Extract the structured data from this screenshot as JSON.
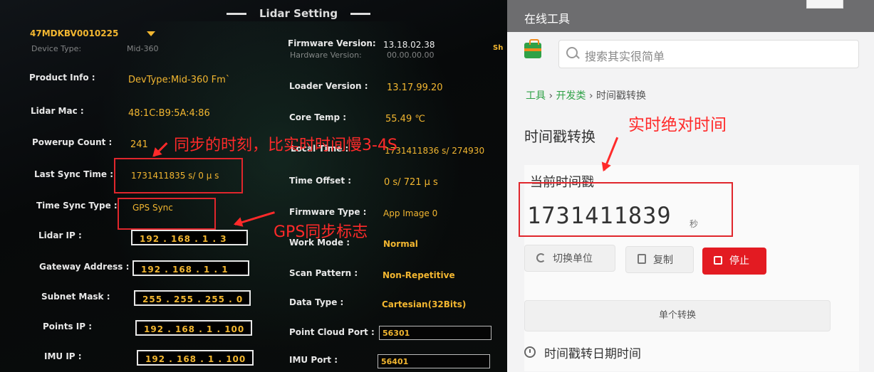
{
  "lidar": {
    "title": "Lidar Setting",
    "device_id": "47MDKBV0010225",
    "cut_top_left": "Device Type:",
    "cut_top_left_value": "Mid-360",
    "cut_top_right": "Hardware Version:",
    "cut_top_right_value": "00.00.00.00",
    "sh_label": "Sh",
    "left_fields": [
      {
        "label": "Product Info :",
        "value": "DevType:Mid-360 Fm`"
      },
      {
        "label": "Lidar Mac :",
        "value": "48:1C:B9:5A:4:86"
      },
      {
        "label": "Powerup Count :",
        "value": "241"
      },
      {
        "label": "Last Sync Time :",
        "value": "1731411835 s/ 0 μ s"
      },
      {
        "label": "Time Sync Type :",
        "value": "GPS Sync"
      }
    ],
    "ip_fields": [
      {
        "label": "Lidar IP :",
        "value": "192 . 168 . 1 . 3"
      },
      {
        "label": "Gateway Address :",
        "value": "192 . 168 . 1 . 1"
      },
      {
        "label": "Subnet Mask :",
        "value": "255 . 255 . 255 . 0"
      },
      {
        "label": "Points IP :",
        "value": "192 . 168 . 1 . 100"
      },
      {
        "label": "IMU IP :",
        "value": "192 . 168 . 1 . 100"
      }
    ],
    "right_fields": [
      {
        "label": "Firmware Version:",
        "value": "13.18.02.38"
      },
      {
        "label": "Loader Version :",
        "value": "13.17.99.20"
      },
      {
        "label": "Core Temp :",
        "value": "55.49 ℃"
      },
      {
        "label": "Local Time :",
        "value": "1731411836 s/ 274930"
      },
      {
        "label": "Time Offset :",
        "value": "0 s/ 721 μ s"
      },
      {
        "label": "Firmware Type :",
        "value": "App Image 0"
      }
    ],
    "selects": [
      {
        "label": "Work Mode :",
        "value": "Normal"
      },
      {
        "label": "Scan Pattern :",
        "value": "Non-Repetitive"
      },
      {
        "label": "Data Type :",
        "value": "Cartesian(32Bits)"
      }
    ],
    "ports": [
      {
        "label": "Point Cloud Port :",
        "value": "56301"
      },
      {
        "label": "IMU Port :",
        "value": "56401"
      }
    ]
  },
  "annotations": {
    "sync_note": "同步的时刻，比实时时间慢3-4S",
    "gps_note": "GPS同步标志",
    "realtime_note": "实时绝对时间"
  },
  "tool": {
    "window_title": "在线工具",
    "search_placeholder": "搜索其实很简单",
    "breadcrumb": [
      "工具",
      "开发类",
      "时间戳转换"
    ],
    "heading": "时间戳转换",
    "current_label": "当前时间戳",
    "timestamp": "1731411839",
    "unit": "秒",
    "btn_switch": "切换单位",
    "btn_copy": "复制",
    "btn_stop": "停止",
    "btn_single": "单个转换",
    "section2": "时间戳转日期时间"
  },
  "colors": {
    "accent_orange": "#f2b630",
    "annotation_red": "#ff2a2a",
    "stop_red": "#e31b22",
    "brand_green": "#2fa146"
  }
}
